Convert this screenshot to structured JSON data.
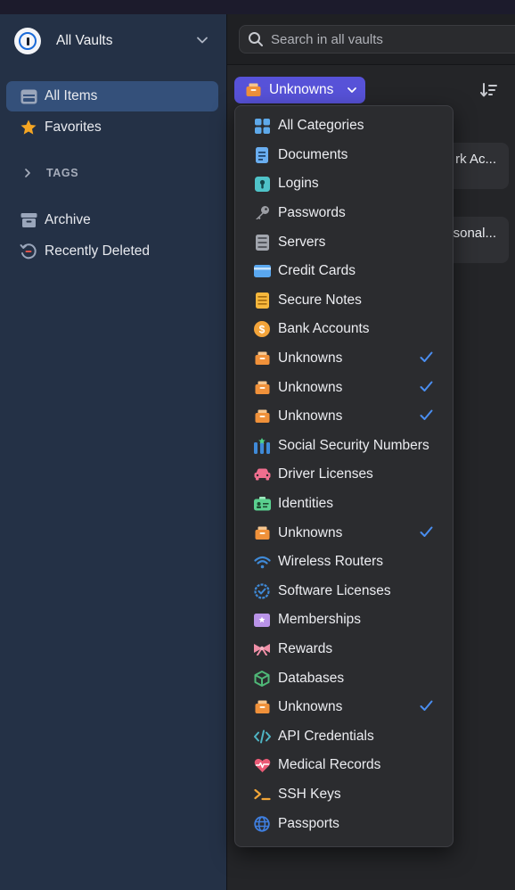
{
  "sidebar": {
    "vault_name": "All Vaults",
    "nav": [
      {
        "label": "All Items",
        "icon": "all-items-icon",
        "active": true
      },
      {
        "label": "Favorites",
        "icon": "star-icon"
      },
      {
        "label": "Archive",
        "icon": "archive-icon"
      },
      {
        "label": "Recently Deleted",
        "icon": "recently-deleted-icon"
      }
    ],
    "tags_label": "TAGS"
  },
  "search": {
    "placeholder": "Search in all vaults"
  },
  "filter": {
    "label": "Unknowns"
  },
  "cards": [
    {
      "text": "rk Ac..."
    },
    {
      "text": "sonal..."
    }
  ],
  "menu": [
    {
      "label": "All Categories",
      "icon": "grid-icon",
      "checked": false
    },
    {
      "label": "Documents",
      "icon": "document-icon",
      "checked": false
    },
    {
      "label": "Logins",
      "icon": "keyhole-icon",
      "checked": false
    },
    {
      "label": "Passwords",
      "icon": "key-icon",
      "checked": false
    },
    {
      "label": "Servers",
      "icon": "server-icon",
      "checked": false
    },
    {
      "label": "Credit Cards",
      "icon": "credit-card-icon",
      "checked": false
    },
    {
      "label": "Secure Notes",
      "icon": "note-icon",
      "checked": false
    },
    {
      "label": "Bank Accounts",
      "icon": "dollar-icon",
      "checked": false
    },
    {
      "label": "Unknowns",
      "icon": "box-icon",
      "checked": true
    },
    {
      "label": "Unknowns",
      "icon": "box-icon",
      "checked": true
    },
    {
      "label": "Unknowns",
      "icon": "box-icon",
      "checked": true
    },
    {
      "label": "Social Security Numbers",
      "icon": "ssn-icon",
      "checked": false
    },
    {
      "label": "Driver Licenses",
      "icon": "car-icon",
      "checked": false
    },
    {
      "label": "Identities",
      "icon": "id-card-icon",
      "checked": false
    },
    {
      "label": "Unknowns",
      "icon": "box-icon",
      "checked": true
    },
    {
      "label": "Wireless Routers",
      "icon": "wifi-icon",
      "checked": false
    },
    {
      "label": "Software Licenses",
      "icon": "badge-icon",
      "checked": false
    },
    {
      "label": "Memberships",
      "icon": "membership-icon",
      "checked": false
    },
    {
      "label": "Rewards",
      "icon": "ribbon-icon",
      "checked": false
    },
    {
      "label": "Databases",
      "icon": "cube-icon",
      "checked": false
    },
    {
      "label": "Unknowns",
      "icon": "box-icon",
      "checked": true
    },
    {
      "label": "API Credentials",
      "icon": "code-icon",
      "checked": false
    },
    {
      "label": "Medical Records",
      "icon": "heart-pulse-icon",
      "checked": false
    },
    {
      "label": "SSH Keys",
      "icon": "terminal-icon",
      "checked": false
    },
    {
      "label": "Passports",
      "icon": "globe-icon",
      "checked": false
    }
  ],
  "colors": {
    "sidebar_bg": "#243146",
    "active_nav": "#34507a",
    "filter_button": "#5752d8",
    "check": "#4a8ef0",
    "unknown_icon": "#f0913a"
  }
}
